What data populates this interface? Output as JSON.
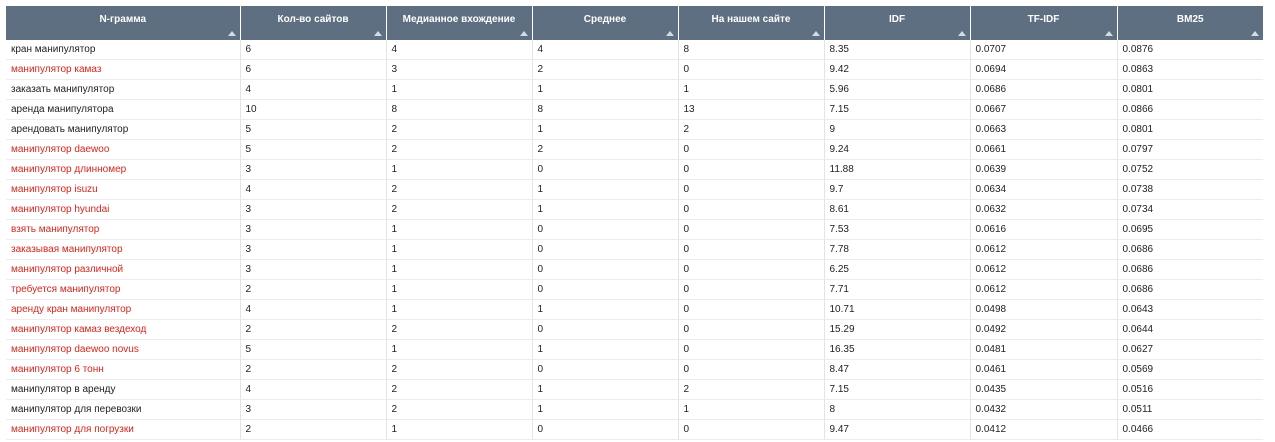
{
  "table": {
    "columns": [
      "N-грамма",
      "Кол-во сайтов",
      "Медианное вхождение",
      "Среднее",
      "На нашем сайте",
      "IDF",
      "TF-IDF",
      "BM25"
    ],
    "rows": [
      {
        "ngram": "кран манипулятор",
        "sites": "6",
        "median": "4",
        "mean": "4",
        "ours": "8",
        "idf": "8.35",
        "tfidf": "0.0707",
        "bm25": "0.0876",
        "missing": false
      },
      {
        "ngram": "манипулятор камаз",
        "sites": "6",
        "median": "3",
        "mean": "2",
        "ours": "0",
        "idf": "9.42",
        "tfidf": "0.0694",
        "bm25": "0.0863",
        "missing": true
      },
      {
        "ngram": "заказать манипулятор",
        "sites": "4",
        "median": "1",
        "mean": "1",
        "ours": "1",
        "idf": "5.96",
        "tfidf": "0.0686",
        "bm25": "0.0801",
        "missing": false
      },
      {
        "ngram": "аренда манипулятора",
        "sites": "10",
        "median": "8",
        "mean": "8",
        "ours": "13",
        "idf": "7.15",
        "tfidf": "0.0667",
        "bm25": "0.0866",
        "missing": false
      },
      {
        "ngram": "арендовать манипулятор",
        "sites": "5",
        "median": "2",
        "mean": "1",
        "ours": "2",
        "idf": "9",
        "tfidf": "0.0663",
        "bm25": "0.0801",
        "missing": false
      },
      {
        "ngram": "манипулятор daewoo",
        "sites": "5",
        "median": "2",
        "mean": "2",
        "ours": "0",
        "idf": "9.24",
        "tfidf": "0.0661",
        "bm25": "0.0797",
        "missing": true
      },
      {
        "ngram": "манипулятор длинномер",
        "sites": "3",
        "median": "1",
        "mean": "0",
        "ours": "0",
        "idf": "11.88",
        "tfidf": "0.0639",
        "bm25": "0.0752",
        "missing": true
      },
      {
        "ngram": "манипулятор isuzu",
        "sites": "4",
        "median": "2",
        "mean": "1",
        "ours": "0",
        "idf": "9.7",
        "tfidf": "0.0634",
        "bm25": "0.0738",
        "missing": true
      },
      {
        "ngram": "манипулятор hyundai",
        "sites": "3",
        "median": "2",
        "mean": "1",
        "ours": "0",
        "idf": "8.61",
        "tfidf": "0.0632",
        "bm25": "0.0734",
        "missing": true
      },
      {
        "ngram": "взять манипулятор",
        "sites": "3",
        "median": "1",
        "mean": "0",
        "ours": "0",
        "idf": "7.53",
        "tfidf": "0.0616",
        "bm25": "0.0695",
        "missing": true
      },
      {
        "ngram": "заказывая манипулятор",
        "sites": "3",
        "median": "1",
        "mean": "0",
        "ours": "0",
        "idf": "7.78",
        "tfidf": "0.0612",
        "bm25": "0.0686",
        "missing": true
      },
      {
        "ngram": "манипулятор различной",
        "sites": "3",
        "median": "1",
        "mean": "0",
        "ours": "0",
        "idf": "6.25",
        "tfidf": "0.0612",
        "bm25": "0.0686",
        "missing": true
      },
      {
        "ngram": "требуется манипулятор",
        "sites": "2",
        "median": "1",
        "mean": "0",
        "ours": "0",
        "idf": "7.71",
        "tfidf": "0.0612",
        "bm25": "0.0686",
        "missing": true
      },
      {
        "ngram": "аренду кран манипулятор",
        "sites": "4",
        "median": "1",
        "mean": "1",
        "ours": "0",
        "idf": "10.71",
        "tfidf": "0.0498",
        "bm25": "0.0643",
        "missing": true
      },
      {
        "ngram": "манипулятор камаз вездеход",
        "sites": "2",
        "median": "2",
        "mean": "0",
        "ours": "0",
        "idf": "15.29",
        "tfidf": "0.0492",
        "bm25": "0.0644",
        "missing": true
      },
      {
        "ngram": "манипулятор daewoo novus",
        "sites": "5",
        "median": "1",
        "mean": "1",
        "ours": "0",
        "idf": "16.35",
        "tfidf": "0.0481",
        "bm25": "0.0627",
        "missing": true
      },
      {
        "ngram": "манипулятор 6 тонн",
        "sites": "2",
        "median": "2",
        "mean": "0",
        "ours": "0",
        "idf": "8.47",
        "tfidf": "0.0461",
        "bm25": "0.0569",
        "missing": true
      },
      {
        "ngram": "манипулятор в аренду",
        "sites": "4",
        "median": "2",
        "mean": "1",
        "ours": "2",
        "idf": "7.15",
        "tfidf": "0.0435",
        "bm25": "0.0516",
        "missing": false
      },
      {
        "ngram": "манипулятор для перевозки",
        "sites": "3",
        "median": "2",
        "mean": "1",
        "ours": "1",
        "idf": "8",
        "tfidf": "0.0432",
        "bm25": "0.0511",
        "missing": false
      },
      {
        "ngram": "манипулятор для погрузки",
        "sites": "2",
        "median": "1",
        "mean": "0",
        "ours": "0",
        "idf": "9.47",
        "tfidf": "0.0412",
        "bm25": "0.0466",
        "missing": true
      }
    ]
  },
  "colors": {
    "header_bg": "#5d6f80",
    "missing_text": "#d9261c",
    "normal_text": "#222222"
  },
  "icons": {
    "sort": "sort-asc-icon"
  }
}
